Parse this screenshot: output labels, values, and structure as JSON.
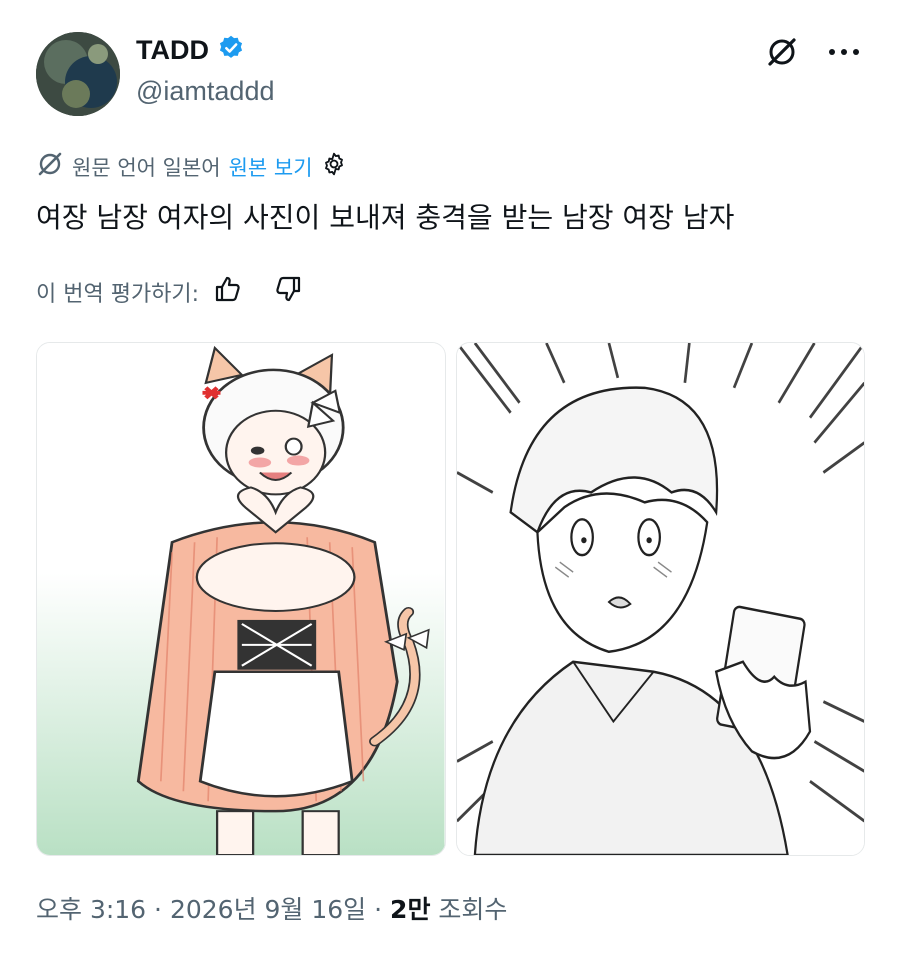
{
  "author": {
    "display_name": "TADD",
    "handle": "@iamtaddd",
    "verified": true,
    "accent_color": "#1d9bf0"
  },
  "translation": {
    "source_language": "원문 언어 일본어",
    "show_original_label": "원본 보기",
    "rate_label": "이 번역 평가하기:"
  },
  "tweet": {
    "text": "여장 남장 여자의 사진이 보내져 충격을 받는 남장 여장 남자"
  },
  "media": [
    {
      "icon": "maid-cat-girl-illustration"
    },
    {
      "icon": "shocked-boy-with-phone-sketch"
    }
  ],
  "meta": {
    "time": "오후 3:16",
    "separator": "·",
    "date": "2026년 9월 16일",
    "views_count": "2만",
    "views_label": "조회수"
  },
  "icons": {
    "grok": "grok-icon",
    "more": "more-icon",
    "translate": "translate-icon",
    "settings": "gear-icon",
    "thumbs_up": "thumbs-up-icon",
    "thumbs_down": "thumbs-down-icon"
  }
}
